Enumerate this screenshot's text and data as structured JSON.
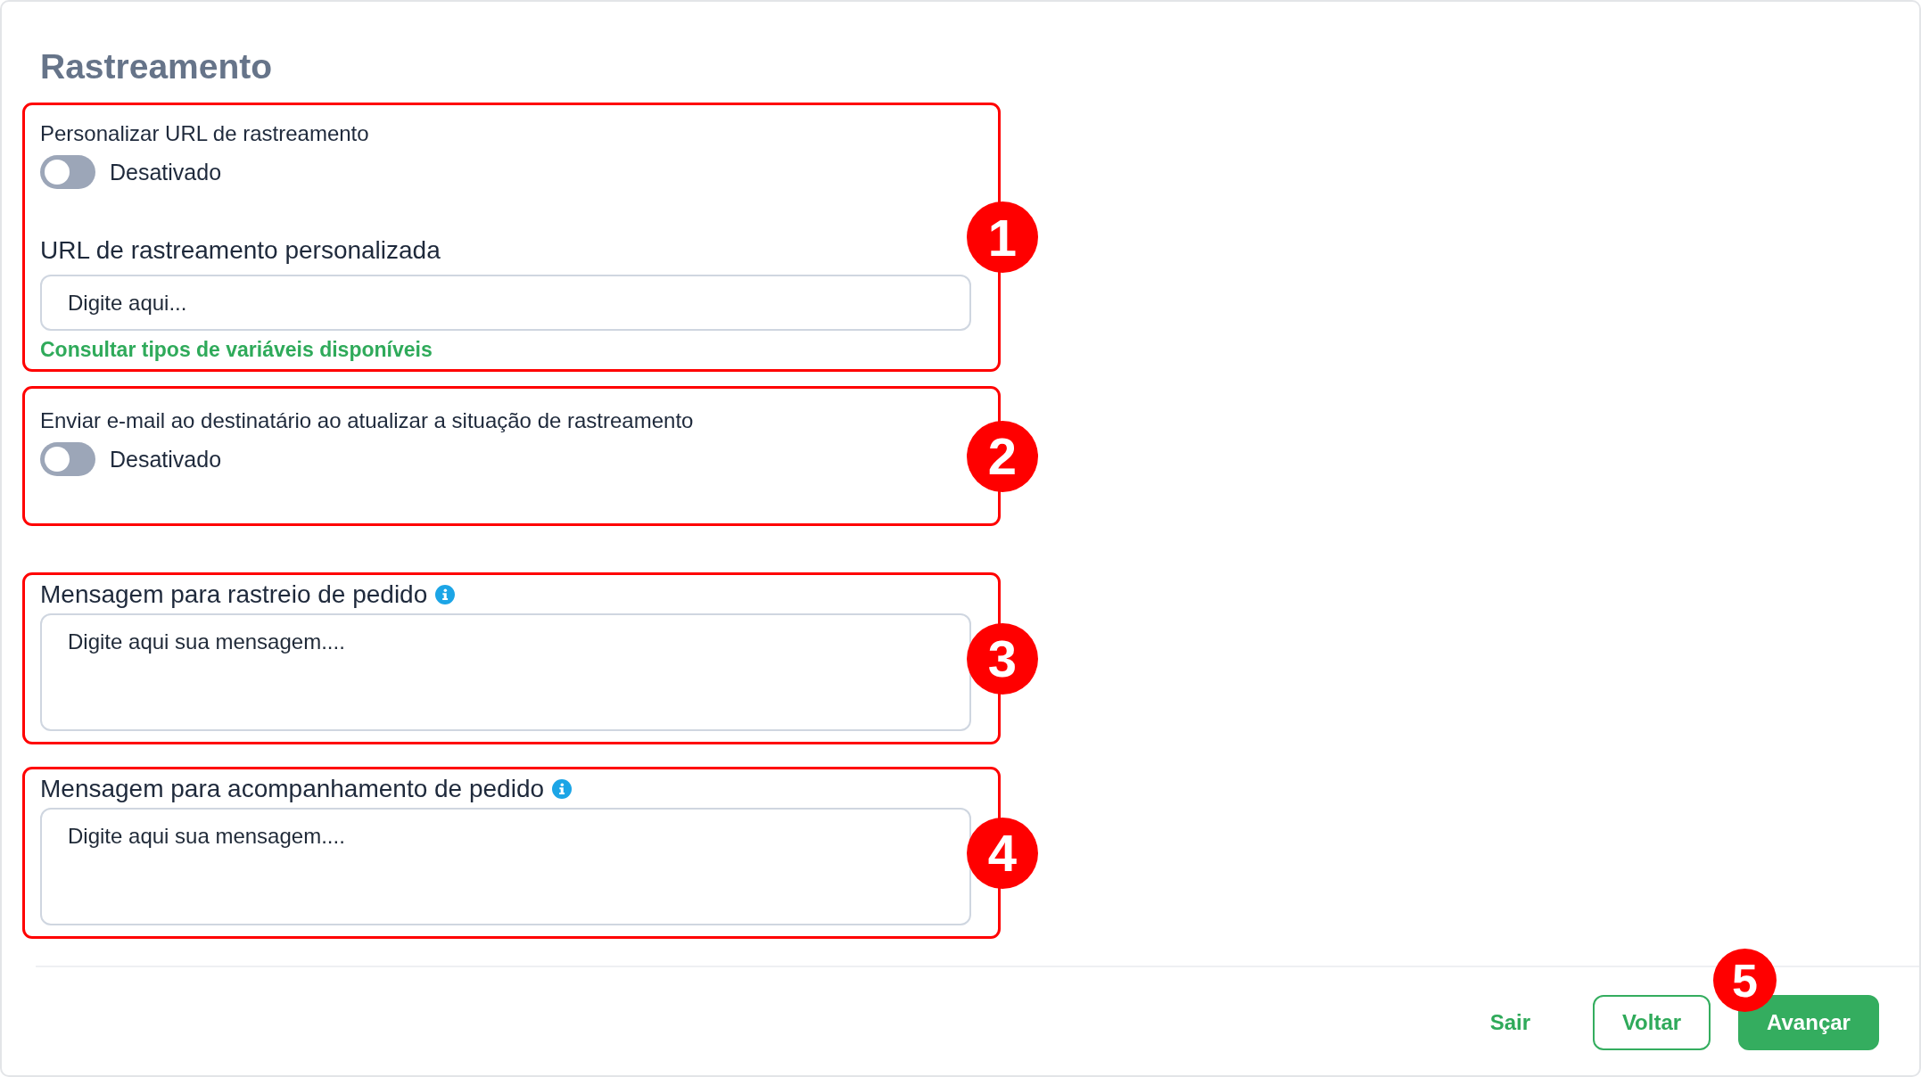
{
  "title": "Rastreamento",
  "sections": [
    {
      "callout": "1",
      "items": [
        {
          "kind": "switch",
          "label": "Personalizar URL de rastreamento",
          "on": false,
          "state_text": "Desativado"
        },
        {
          "kind": "input",
          "label": "URL de rastreamento personalizada",
          "placeholder": "Digite aqui..."
        },
        {
          "kind": "link",
          "text": "Consultar tipos de variáveis disponíveis"
        }
      ]
    },
    {
      "callout": "2",
      "items": [
        {
          "kind": "switch",
          "label": "Enviar e-mail ao destinatário ao atualizar a situação de rastreamento",
          "on": false,
          "state_text": "Desativado"
        }
      ]
    },
    {
      "callout": "3",
      "items": [
        {
          "kind": "textarea",
          "label": "Mensagem para rastreio de pedido",
          "info": true,
          "placeholder": "Digite aqui sua mensagem...."
        }
      ]
    },
    {
      "callout": "4",
      "items": [
        {
          "kind": "textarea",
          "label": "Mensagem para acompanhamento de pedido",
          "info": true,
          "placeholder": "Digite aqui sua mensagem...."
        }
      ]
    }
  ],
  "footer": {
    "buttons": [
      {
        "kind": "text",
        "label": "Sair"
      },
      {
        "kind": "outline",
        "label": "Voltar"
      },
      {
        "kind": "primary",
        "label": "Avançar",
        "callout": "5"
      }
    ]
  }
}
